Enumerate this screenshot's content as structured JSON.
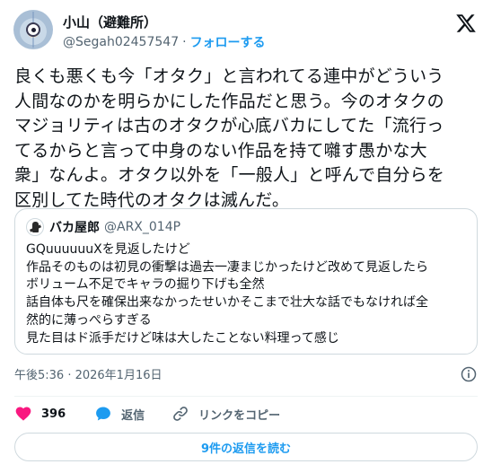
{
  "author": {
    "display_name": "小山（避難所）",
    "handle": "@Segah02457547",
    "separator": "·",
    "follow_label": "フォローする"
  },
  "tweet": {
    "lines": [
      "良くも悪くも今「オタク」と言われてる連中がどういう",
      "人間なのかを明らかにした作品だと思う。今のオタクの",
      "マジョリティは古のオタクが心底バカにしてた「流行っ",
      "てるからと言って中身のない作品を持て囃す愚かな大",
      "衆」なんよ。オタク以外を「一般人」と呼んで自分らを",
      "区別してた時代のオタクは滅んだ。"
    ]
  },
  "quoted": {
    "display_name": "バカ屋郎",
    "handle": "@ARX_014P",
    "lines": [
      "GQuuuuuuXを見返したけど",
      "作品そのものは初見の衝撃は過去一凄まじかったけど改めて見返したら",
      "ボリューム不足でキャラの掘り下げも全然",
      "話自体も尺を確保出来なかったせいかそこまで壮大な話でもなければ全",
      "然的に薄っぺらすぎる",
      "見た目はド派手だけど味は大したことない料理って感じ"
    ]
  },
  "timestamp": "午後5:36 · 2026年1月16日",
  "actions": {
    "like_count": "396",
    "reply_label": "返信",
    "copy_link_label": "リンクをコピー"
  },
  "read_replies_label": "9件の返信を読む",
  "colors": {
    "accent": "#1d9bf0",
    "like": "#f91880",
    "text": "#0f1419",
    "secondary": "#536471",
    "border": "#cfd9de"
  },
  "icons": {
    "brand": "x-logo-icon",
    "like": "heart-icon",
    "reply": "speech-bubble-icon",
    "copy_link": "link-icon",
    "info": "info-icon"
  }
}
